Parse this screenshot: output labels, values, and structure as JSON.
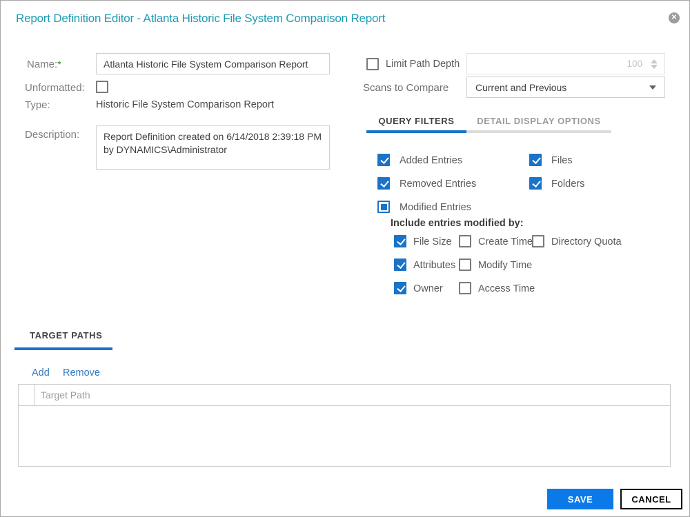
{
  "dialog": {
    "title": "Report Definition Editor - Atlanta Historic File System Comparison Report"
  },
  "form": {
    "name_label": "Name:",
    "required_mark": "*",
    "name_value": "Atlanta Historic File System Comparison Report",
    "unformatted_label": "Unformatted:",
    "unformatted_state": "unchecked",
    "type_label": "Type:",
    "type_value": "Historic File System Comparison Report",
    "description_label": "Description:",
    "description_value": "Report Definition created on 6/14/2018 2:39:18 PM by DYNAMICS\\Administrator"
  },
  "options": {
    "limit_path_depth_label": "Limit Path Depth",
    "limit_path_depth_state": "unchecked",
    "path_depth_value": "100",
    "scans_label": "Scans to Compare",
    "scans_value": "Current and Previous"
  },
  "tabs": {
    "query_filters": "QUERY FILTERS",
    "detail_display_options": "DETAIL DISPLAY OPTIONS"
  },
  "filters": {
    "items": [
      {
        "label": "Added Entries",
        "state": "checked"
      },
      {
        "label": "Files",
        "state": "checked"
      },
      {
        "label": "Removed Entries",
        "state": "checked"
      },
      {
        "label": "Folders",
        "state": "checked"
      },
      {
        "label": "Modified Entries",
        "state": "indeterminate"
      }
    ],
    "modified_by_heading": "Include entries modified by:",
    "modified_by_items": [
      {
        "label": "File Size",
        "state": "checked"
      },
      {
        "label": "Create Time",
        "state": "unchecked"
      },
      {
        "label": "Directory Quota",
        "state": "unchecked"
      },
      {
        "label": "Attributes",
        "state": "checked"
      },
      {
        "label": "Modify Time",
        "state": "unchecked"
      },
      {
        "label": "Owner",
        "state": "checked"
      },
      {
        "label": "Access Time",
        "state": "unchecked"
      }
    ]
  },
  "target_paths": {
    "tab_label": "TARGET PATHS",
    "add_label": "Add",
    "remove_label": "Remove",
    "column_header": "Target Path"
  },
  "actions": {
    "save_label": "SAVE",
    "cancel_label": "CANCEL"
  },
  "colors": {
    "title_teal": "#1e9cb3",
    "checkbox_blue": "#1a73c8",
    "save_blue": "#0b79e8",
    "link_blue": "#3379c0"
  }
}
